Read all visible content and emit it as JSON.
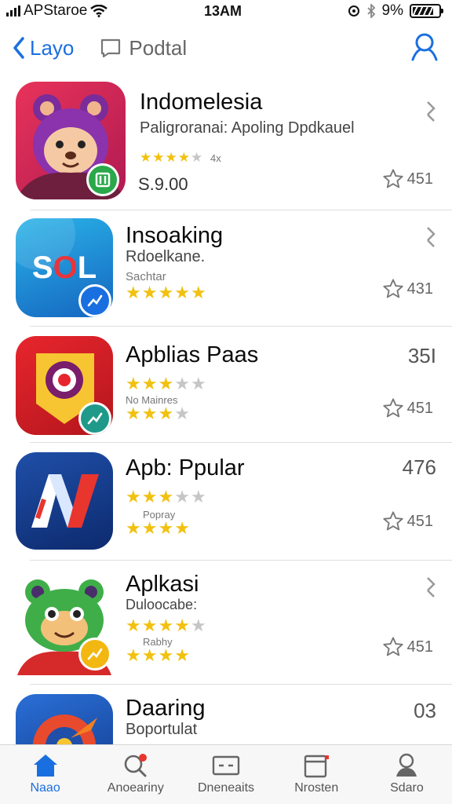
{
  "status": {
    "carrier": "APStaroe",
    "time": "13AM",
    "battery": "9%"
  },
  "nav": {
    "back_label": "Layo",
    "title": "Podtal"
  },
  "apps": [
    {
      "name": "Indomelesia",
      "subtitle": "Paligroranai: Apoling Dpdkauel",
      "tiny": "4x",
      "price": "S.9.00",
      "count": "451",
      "accessory": "chevron",
      "rating": 4
    },
    {
      "name": "Insoaking",
      "subtitle": "Rdoelkane.",
      "tiny": "Sachtar",
      "count": "431",
      "accessory": "chevron",
      "rating": 5
    },
    {
      "name": "Apblias Paas",
      "tiny": "No Mainres",
      "count": "451",
      "right_value": "35I",
      "accessory": "number",
      "rating": 3,
      "rating2": 3
    },
    {
      "name": "Apb: Ppular",
      "tiny": "Popray",
      "count": "451",
      "right_value": "476",
      "accessory": "number",
      "rating": 3,
      "rating2": 4
    },
    {
      "name": "Aplkasi",
      "subtitle": "Duloocabe:",
      "tiny": "Rabhy",
      "count": "451",
      "accessory": "chevron",
      "rating": 4,
      "rating2": 4
    },
    {
      "name": "Daaring",
      "subtitle": "Boportulat",
      "right_value": "03",
      "accessory": "number"
    }
  ],
  "tabs": [
    {
      "label": "Naao",
      "icon": "home-icon",
      "active": true
    },
    {
      "label": "Anoeariny",
      "icon": "search-icon"
    },
    {
      "label": "Dneneaits",
      "icon": "ticket-icon"
    },
    {
      "label": "Nrosten",
      "icon": "window-icon"
    },
    {
      "label": "Sdaro",
      "icon": "person-icon"
    }
  ],
  "colors": {
    "accent": "#1a6fe0",
    "star": "#f2c10e"
  }
}
